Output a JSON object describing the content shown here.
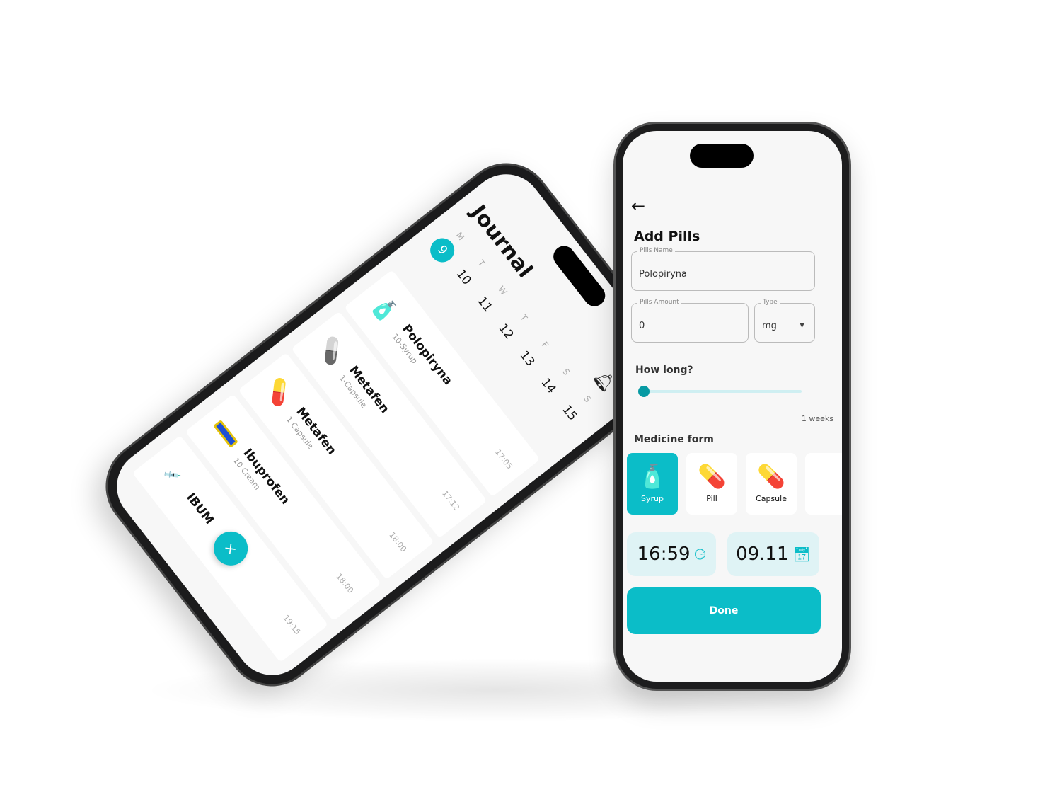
{
  "journal": {
    "title": "Journal",
    "days": [
      {
        "l": "M",
        "n": "9"
      },
      {
        "l": "T",
        "n": "10"
      },
      {
        "l": "W",
        "n": "11"
      },
      {
        "l": "T",
        "n": "12"
      },
      {
        "l": "F",
        "n": "13"
      },
      {
        "l": "S",
        "n": "14"
      },
      {
        "l": "S",
        "n": "15"
      }
    ],
    "selected_day": "9",
    "items": [
      {
        "name": "Polopiryna",
        "sub": "10-Syrup",
        "time": "17:05",
        "icon": "syrup-bottle-icon"
      },
      {
        "name": "Metafen",
        "sub": "1-Capsule",
        "time": "17:12",
        "icon": "capsule-icon"
      },
      {
        "name": "Metafen",
        "sub": "1 Capsule",
        "time": "18:00",
        "icon": "capsule-icon"
      },
      {
        "name": "Ibuprofen",
        "sub": "10 Cream",
        "time": "18:00",
        "icon": "cream-tube-icon"
      },
      {
        "name": "IBUM",
        "sub": "",
        "time": "19:15",
        "icon": "syringe-icon"
      }
    ],
    "fab": "×"
  },
  "add_pills": {
    "title": "Add Pills",
    "pills_name_label": "Pills Name",
    "pills_name_value": "Polopiryna",
    "pills_amount_label": "Pills Amount",
    "pills_amount_value": "0",
    "type_label": "Type",
    "type_value": "mg",
    "how_long": "How long?",
    "duration": "1 weeks",
    "slider_fraction": 0,
    "medicine_form": "Medicine form",
    "forms": [
      {
        "label": "Syrup",
        "selected": true
      },
      {
        "label": "Pill"
      },
      {
        "label": "Capsule"
      }
    ],
    "time": "16:59",
    "date": "09.11",
    "done": "Done"
  },
  "colors": {
    "accent": "#0bbdc8",
    "light_accent": "#dff3f5"
  }
}
